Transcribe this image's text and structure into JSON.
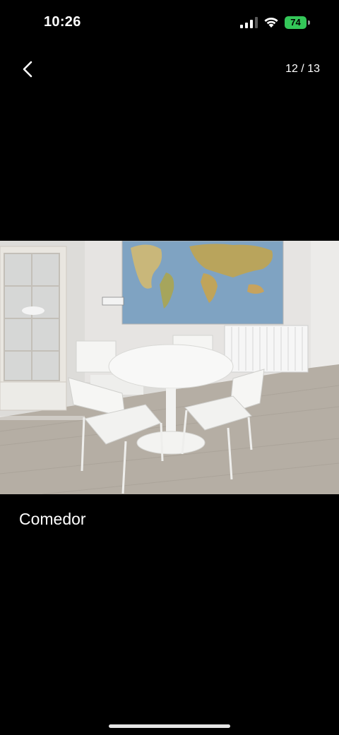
{
  "status_bar": {
    "time": "10:26",
    "battery_level": "74",
    "battery_color": "#34c759",
    "signal_icon": "cellular-signal-icon",
    "wifi_icon": "wifi-icon"
  },
  "nav": {
    "back_icon": "chevron-left-icon",
    "page_counter": "12 / 13"
  },
  "photo": {
    "subject": "dining room"
  },
  "caption": "Comedor"
}
